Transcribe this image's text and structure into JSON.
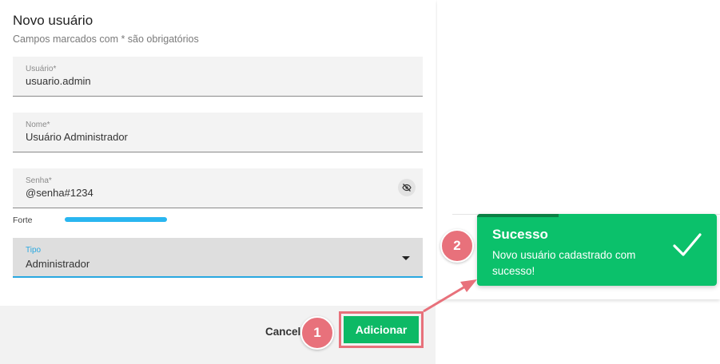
{
  "dialog": {
    "title": "Novo usuário",
    "subtitle": "Campos marcados com * são obrigatórios",
    "fields": {
      "username": {
        "label": "Usuário*",
        "value": "usuario.admin"
      },
      "name": {
        "label": "Nome*",
        "value": "Usuário Administrador"
      },
      "password": {
        "label": "Senha*",
        "value": "@senha#1234"
      },
      "type": {
        "label": "Tipo",
        "value": "Administrador"
      }
    },
    "strength": {
      "label": "Forte",
      "level": 1.0
    },
    "footer": {
      "cancel_label": "Cancel",
      "add_label": "Adicionar"
    }
  },
  "toast": {
    "title": "Sucesso",
    "message": "Novo usuário cadastrado com sucesso!",
    "progress": 0.34
  },
  "annotations": {
    "step1": "1",
    "step2": "2"
  },
  "icons": {
    "password_toggle": "eye-off-icon",
    "select_arrow": "chevron-down-icon",
    "toast_check": "check-icon"
  },
  "colors": {
    "accent_blue": "#29a8e0",
    "success_green": "#0bc16b",
    "button_green": "#0db965",
    "annotation_red": "#e8717b"
  }
}
